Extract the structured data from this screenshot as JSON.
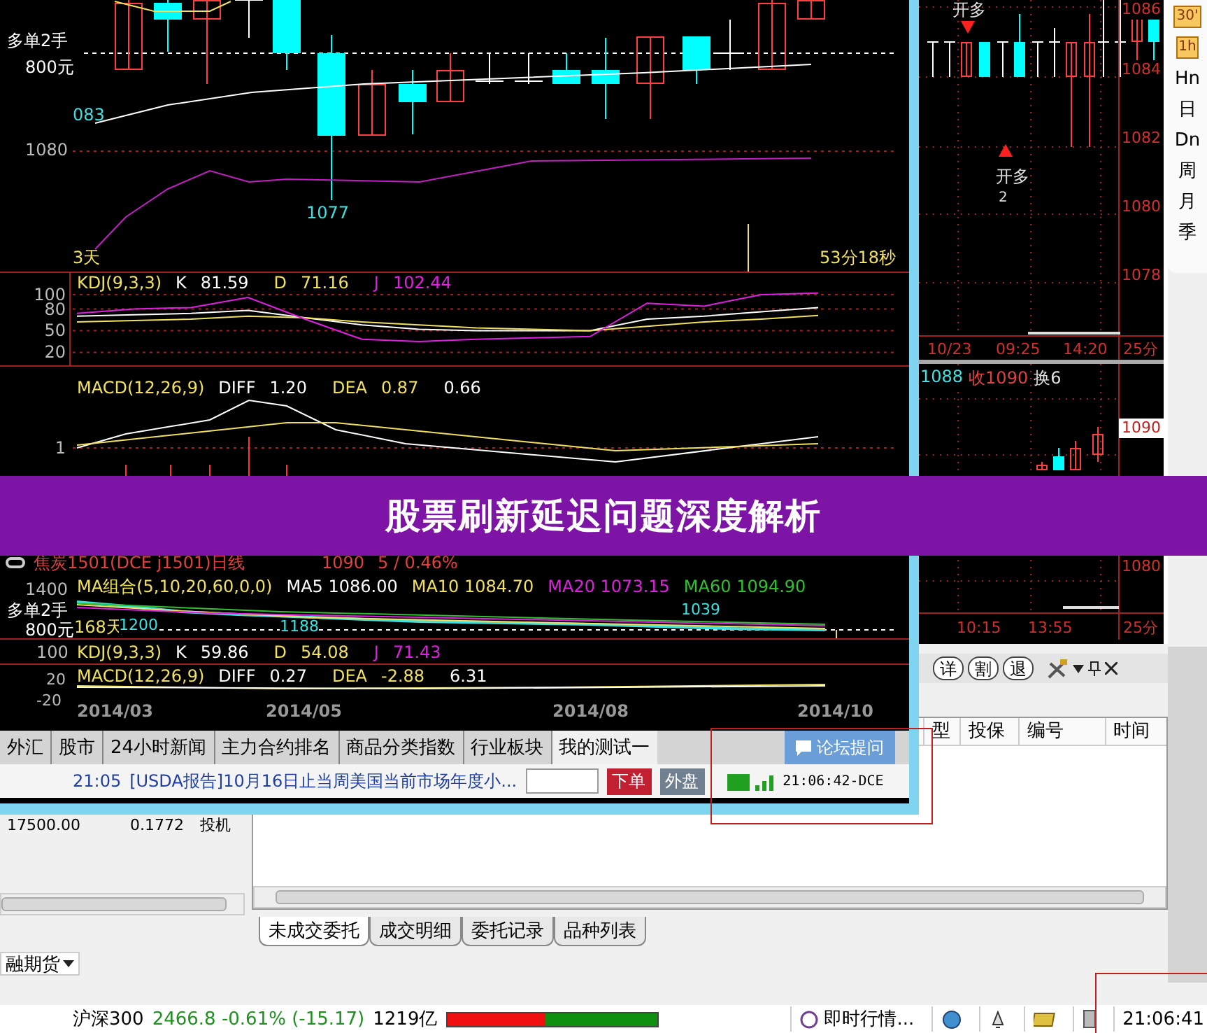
{
  "main_chart": {
    "position_label": "多单2手",
    "margin_label": "800元",
    "price_labels": [
      {
        "kind": "high",
        "text": "083"
      },
      {
        "kind": "axis",
        "text": "1080"
      },
      {
        "kind": "low",
        "text": "1077"
      }
    ],
    "period": "3天",
    "countdown": "53分18秒",
    "kdj": {
      "name": "KDJ(9,3,3)",
      "values": [
        {
          "value": "81.59",
          "color": "#ffffff"
        },
        {
          "value": "71.16",
          "color": "#f0e060"
        },
        {
          "value": "102.44",
          "color": "#e020e0"
        }
      ],
      "chart_data": {
        "type": "line",
        "ylim": [
          0,
          130
        ],
        "grid": true,
        "yticks": [
          100,
          80,
          50,
          20
        ],
        "series": [
          {
            "name": "K",
            "color": "#ffffff",
            "values": [
              70,
              72,
              74,
              78,
              68,
              58,
              52,
              50,
              50,
              50,
              66,
              70,
              76,
              82
            ]
          },
          {
            "name": "D",
            "color": "#f0e060",
            "values": [
              62,
              64,
              66,
              70,
              68,
              62,
              58,
              54,
              52,
              50,
              56,
              62,
              66,
              71
            ]
          },
          {
            "name": "J",
            "color": "#e020e0",
            "values": [
              74,
              80,
              82,
              96,
              66,
              38,
              35,
              38,
              40,
              42,
              88,
              84,
              100,
              102
            ]
          }
        ]
      }
    },
    "macd": {
      "name": "MACD(12,26,9)",
      "values": [
        {
          "label": "DIFF",
          "value": "1.20",
          "color": "#ffffff"
        },
        {
          "label": "DEA",
          "value": "0.87",
          "color": "#f0e060"
        },
        {
          "value": "0.66",
          "color": "#ffffff"
        }
      ],
      "ticks": [
        "1"
      ]
    }
  },
  "overview": {
    "title": "焦炭1501(DCE j1501)日线",
    "price": "1090",
    "change": "5 / 0.46%",
    "ma_name": "MA组合(5,10,20,60,0,0)",
    "ma": [
      {
        "label": "MA5 1086.00",
        "color": "#ffffff"
      },
      {
        "label": "MA10 1084.70",
        "color": "#f0e060"
      },
      {
        "label": "MA20 1073.15",
        "color": "#e020e0"
      },
      {
        "label": "MA60 1094.90",
        "color": "#30c030"
      }
    ],
    "position_label": "多单2手",
    "margin_label": "800元",
    "days": "168天",
    "price_marks": [
      "1200",
      "1188",
      "1039"
    ],
    "ticks": [
      "1400",
      "100",
      "20",
      "-20"
    ],
    "kdj": {
      "name": "KDJ(9,3,3)",
      "values": [
        {
          "label": "K",
          "value": "59.86",
          "color": "#ffffff"
        },
        {
          "label": "D",
          "value": "54.08",
          "color": "#f0e060"
        },
        {
          "label": "J",
          "value": "71.43",
          "color": "#e020e0"
        }
      ]
    },
    "macd": {
      "name": "MACD(12,26,9)",
      "values": [
        {
          "label": "DIFF",
          "value": "0.27",
          "color": "#ffffff"
        },
        {
          "label": "DEA",
          "value": "-2.88",
          "color": "#f0e060"
        },
        {
          "value": "6.31",
          "color": "#ffffff"
        }
      ]
    },
    "dates": [
      "2014/03",
      "2014/05",
      "2014/08",
      "2014/10"
    ]
  },
  "tabs": [
    {
      "label": "外汇",
      "selected": false
    },
    {
      "label": "股市",
      "selected": false
    },
    {
      "label": "24小时新闻",
      "selected": false
    },
    {
      "label": "主力合约排名",
      "selected": false
    },
    {
      "label": "商品分类指数",
      "selected": false
    },
    {
      "label": "行业板块",
      "selected": false
    },
    {
      "label": "我的测试一",
      "selected": true
    }
  ],
  "forum_button": "论坛提问",
  "news": {
    "time": "21:05",
    "headline": "[USDA报告]10月16日止当周美国当前市场年度小...",
    "order_button": "下单",
    "outer_button": "外盘",
    "clock": "21:06:42-DCE"
  },
  "intraday_chart": {
    "price_ticks": [
      "1086",
      "1084",
      "1082",
      "1080",
      "1078"
    ],
    "signals": [
      {
        "kind": "sell",
        "text": "开多"
      },
      {
        "kind": "buy",
        "text": "开多",
        "count": "2"
      }
    ],
    "times": [
      "10/23",
      "09:25",
      "14:20"
    ],
    "interval": "25分"
  },
  "minute_chart": {
    "quotes": [
      {
        "text": "1088",
        "color": "#40e0e0"
      },
      {
        "text": "收1090",
        "color": "#e04040"
      },
      {
        "text": "换6",
        "color": "#e0e0e0"
      }
    ],
    "price_badge": "1090",
    "price_ticks": [
      "1080"
    ],
    "times": [
      "10:15",
      "13:55"
    ],
    "interval": "25分"
  },
  "periods": [
    {
      "label": "30'",
      "kind": "badge"
    },
    {
      "label": "1h",
      "kind": "badge"
    },
    {
      "label": "Hn",
      "kind": "text"
    },
    {
      "label": "日",
      "kind": "text"
    },
    {
      "label": "Dn",
      "kind": "text"
    },
    {
      "label": "周",
      "kind": "text"
    },
    {
      "label": "月",
      "kind": "text"
    },
    {
      "label": "季",
      "kind": "text"
    }
  ],
  "toolbar": {
    "buttons": [
      "详",
      "割",
      "退"
    ]
  },
  "orders_table": {
    "columns": [
      "型",
      "投保",
      "编号",
      "时间"
    ]
  },
  "position_row": [
    "17500.00",
    "0.1772",
    "投机"
  ],
  "bottom_tabs": [
    {
      "label": "未成交委托",
      "selected": true
    },
    {
      "label": "成交明细",
      "selected": false
    },
    {
      "label": "委托记录",
      "selected": false
    },
    {
      "label": "品种列表",
      "selected": false
    }
  ],
  "market_select": "融期货",
  "status_bar": {
    "index_name": "沪深300",
    "quote": "2466.8 -0.61% (-15.17)",
    "turnover": "1219亿",
    "level": 0.47,
    "ticker": "即时行情...",
    "time": "21:06:41"
  },
  "banner": {
    "title": "股票刷新延迟问题深度解析"
  }
}
